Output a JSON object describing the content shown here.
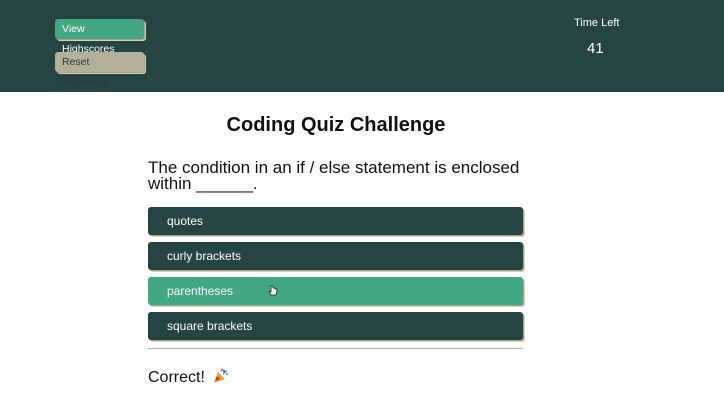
{
  "header": {
    "view_highscores_label": "View Highscores",
    "reset_highscore_label": "Reset Highscore",
    "time_left_label": "Time Left",
    "time_left_value": "41"
  },
  "quiz": {
    "title": "Coding Quiz Challenge",
    "question": "The condition in an if / else statement is enclosed within ______.",
    "answers": [
      "quotes",
      "curly brackets",
      "parentheses",
      "square brackets"
    ],
    "selected_answer_index": 2
  },
  "feedback": {
    "text": "Correct!",
    "icon": "party-popper-icon"
  },
  "colors": {
    "header_bg": "#264441",
    "accent_green": "#41a882",
    "answer_bg": "#264441",
    "reset_btn_bg": "#b3b09c"
  }
}
